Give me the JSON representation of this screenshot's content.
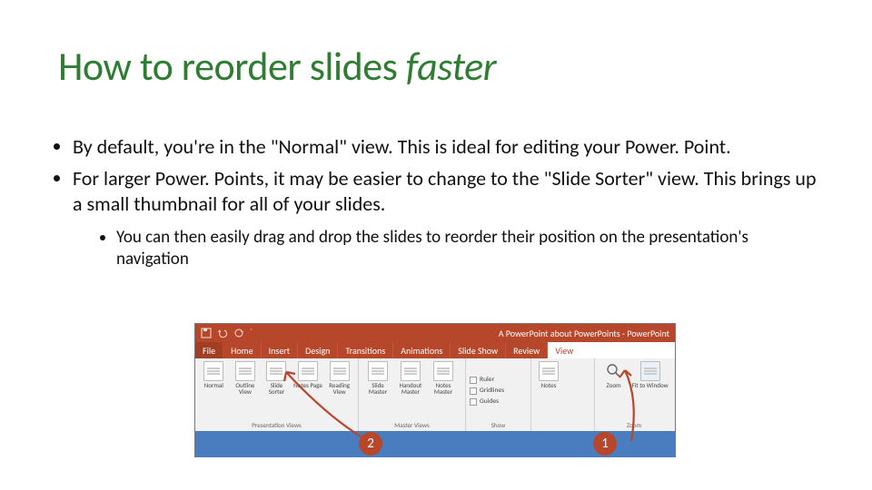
{
  "title_prefix": "How to reorder slides ",
  "title_emph": "faster",
  "bullets": {
    "b1": "By default, you're in the \"Normal\" view. This is ideal for editing your Power. Point.",
    "b2": "For larger Power. Points, it may be easier to change to the \"Slide Sorter\" view. This brings up a small thumbnail for all of your slides.",
    "b2a": "You can then easily drag and drop the slides to reorder their position on the presentation's navigation"
  },
  "qat_title": "A PowerPoint about PowerPoints - PowerPoint",
  "tabs": {
    "file": "File",
    "home": "Home",
    "insert": "Insert",
    "design": "Design",
    "transitions": "Transitions",
    "animations": "Animations",
    "slideshow": "Slide Show",
    "review": "Review",
    "view": "View"
  },
  "ribbon": {
    "presentation_views": {
      "label": "Presentation Views",
      "normal": "Normal",
      "outline": "Outline View",
      "slide_sorter": "Slide Sorter",
      "notes_page": "Notes Page",
      "reading": "Reading View"
    },
    "master_views": {
      "label": "Master Views",
      "slide_master": "Slide Master",
      "handout_master": "Handout Master",
      "notes_master": "Notes Master"
    },
    "show": {
      "label": "Show",
      "ruler": "Ruler",
      "gridlines": "Gridlines",
      "guides": "Guides"
    },
    "zoom": {
      "label": "Zoom",
      "zoom_btn": "Zoom",
      "fit": "Fit to Window"
    }
  },
  "markers": {
    "one": "1",
    "two": "2"
  }
}
